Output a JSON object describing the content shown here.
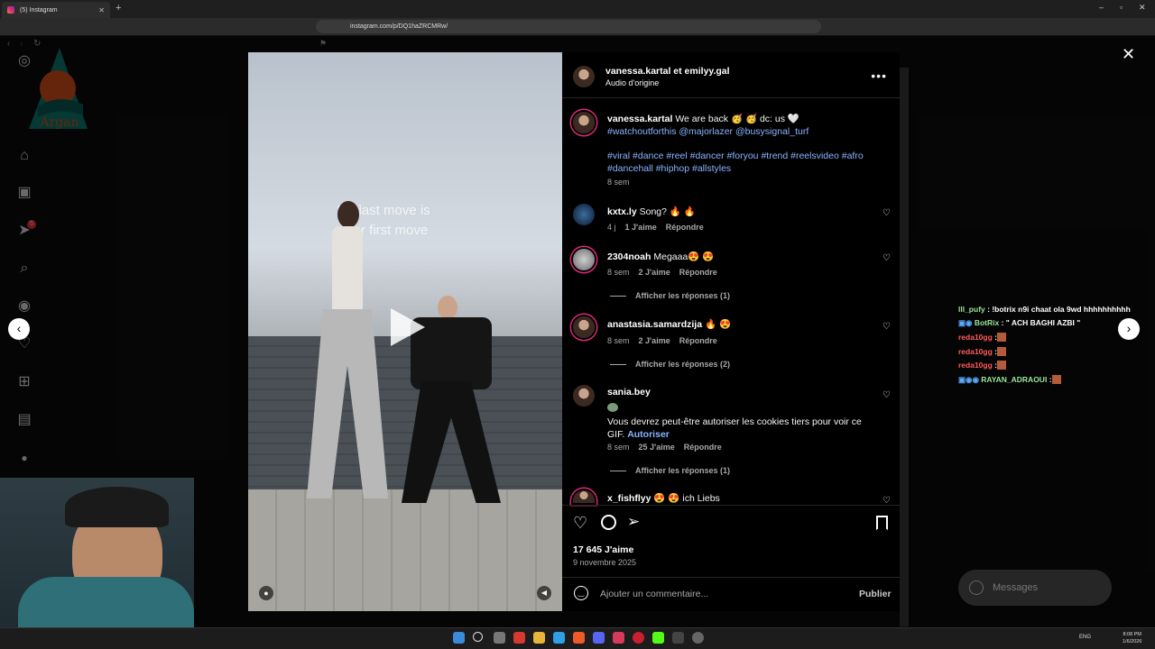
{
  "browser": {
    "tab_title": "(5) Instagram",
    "url": "instagram.com/p/DQ1haZRCMRw/"
  },
  "video": {
    "overlay_text_1": "My last move is",
    "overlay_text_2": "your first move"
  },
  "post": {
    "header_user": "vanessa.kartal et emilyy.gal",
    "audio": "Audio d'origine",
    "caption_user": "vanessa.kartal",
    "caption_text": "We are back 🥳 🥳 dc: us 🤍",
    "caption_mentions": "#watchoutforthis @majorlazer @busysignal_turf",
    "hashtags_1": "#viral #dance #reel #dancer #foryou #trend #reelsvideo #afro",
    "hashtags_2": "#dancehall #hiphop #allstyles",
    "caption_time": "8 sem",
    "likes": "17 645 J'aime",
    "date": "9 novembre 2025",
    "comment_placeholder": "Ajouter un commentaire...",
    "publish": "Publier"
  },
  "comments": [
    {
      "user": "kxtx.ly",
      "text": "Song? 🔥 🔥",
      "time": "4 j",
      "likes": "1 J'aime",
      "reply": "Répondre"
    },
    {
      "user": "2304noah",
      "text": "Megaaa😍 😍",
      "time": "8 sem",
      "likes": "2 J'aime",
      "reply": "Répondre",
      "replies": "Afficher les réponses (1)"
    },
    {
      "user": "anastasia.samardzija",
      "text": "🔥 😍",
      "time": "8 sem",
      "likes": "2 J'aime",
      "reply": "Répondre",
      "replies": "Afficher les réponses (2)"
    },
    {
      "user": "sania.bey",
      "text": "Vous devrez peut-être autoriser les cookies tiers pour voir ce",
      "text2": "GIF.",
      "link": "Autoriser",
      "time": "8 sem",
      "likes": "25 J'aime",
      "reply": "Répondre",
      "replies": "Afficher les réponses (1)"
    },
    {
      "user": "x_fishflyy",
      "text": "😍 😍 ich Liebs"
    }
  ],
  "chat": [
    {
      "user": "lll_pufy",
      "msg": ": !botrix n9i chaat ola 9wd hhhhhhhhhh",
      "color": "#9be59b"
    },
    {
      "user": "BotRix",
      "msg": ": \" ACH BAGHI AZBI \"",
      "color": "#9be59b"
    },
    {
      "user": "reda10gg",
      "msg": ":",
      "color": "#ff5a5a"
    },
    {
      "user": "reda10gg",
      "msg": ":",
      "color": "#ff5a5a"
    },
    {
      "user": "reda10gg",
      "msg": ":",
      "color": "#ff5a5a"
    },
    {
      "user": "RAYAN_ADRAOUI",
      "msg": ":",
      "color": "#9be59b"
    }
  ],
  "messages_label": "Messages",
  "sidebar_badge": "5",
  "tray": {
    "lang": "ENG",
    "time": "8:08 PM",
    "date": "1/6/2026"
  }
}
